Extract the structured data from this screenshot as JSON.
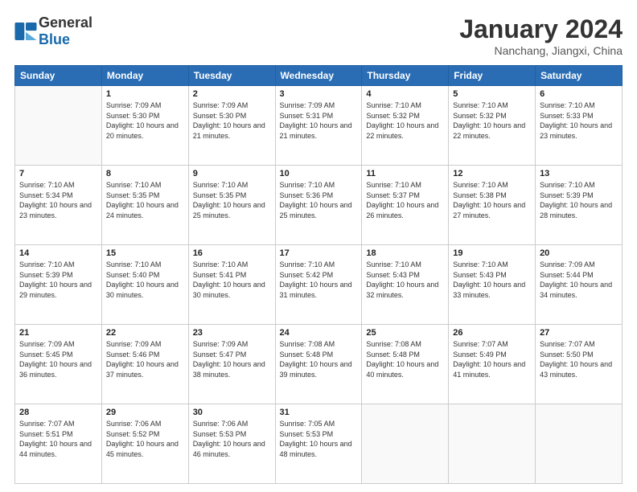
{
  "logo": {
    "text_general": "General",
    "text_blue": "Blue"
  },
  "header": {
    "month": "January 2024",
    "location": "Nanchang, Jiangxi, China"
  },
  "weekdays": [
    "Sunday",
    "Monday",
    "Tuesday",
    "Wednesday",
    "Thursday",
    "Friday",
    "Saturday"
  ],
  "weeks": [
    [
      {
        "day": "",
        "sunrise": "",
        "sunset": "",
        "daylight": ""
      },
      {
        "day": "1",
        "sunrise": "Sunrise: 7:09 AM",
        "sunset": "Sunset: 5:30 PM",
        "daylight": "Daylight: 10 hours and 20 minutes."
      },
      {
        "day": "2",
        "sunrise": "Sunrise: 7:09 AM",
        "sunset": "Sunset: 5:30 PM",
        "daylight": "Daylight: 10 hours and 21 minutes."
      },
      {
        "day": "3",
        "sunrise": "Sunrise: 7:09 AM",
        "sunset": "Sunset: 5:31 PM",
        "daylight": "Daylight: 10 hours and 21 minutes."
      },
      {
        "day": "4",
        "sunrise": "Sunrise: 7:10 AM",
        "sunset": "Sunset: 5:32 PM",
        "daylight": "Daylight: 10 hours and 22 minutes."
      },
      {
        "day": "5",
        "sunrise": "Sunrise: 7:10 AM",
        "sunset": "Sunset: 5:32 PM",
        "daylight": "Daylight: 10 hours and 22 minutes."
      },
      {
        "day": "6",
        "sunrise": "Sunrise: 7:10 AM",
        "sunset": "Sunset: 5:33 PM",
        "daylight": "Daylight: 10 hours and 23 minutes."
      }
    ],
    [
      {
        "day": "7",
        "sunrise": "Sunrise: 7:10 AM",
        "sunset": "Sunset: 5:34 PM",
        "daylight": "Daylight: 10 hours and 23 minutes."
      },
      {
        "day": "8",
        "sunrise": "Sunrise: 7:10 AM",
        "sunset": "Sunset: 5:35 PM",
        "daylight": "Daylight: 10 hours and 24 minutes."
      },
      {
        "day": "9",
        "sunrise": "Sunrise: 7:10 AM",
        "sunset": "Sunset: 5:35 PM",
        "daylight": "Daylight: 10 hours and 25 minutes."
      },
      {
        "day": "10",
        "sunrise": "Sunrise: 7:10 AM",
        "sunset": "Sunset: 5:36 PM",
        "daylight": "Daylight: 10 hours and 25 minutes."
      },
      {
        "day": "11",
        "sunrise": "Sunrise: 7:10 AM",
        "sunset": "Sunset: 5:37 PM",
        "daylight": "Daylight: 10 hours and 26 minutes."
      },
      {
        "day": "12",
        "sunrise": "Sunrise: 7:10 AM",
        "sunset": "Sunset: 5:38 PM",
        "daylight": "Daylight: 10 hours and 27 minutes."
      },
      {
        "day": "13",
        "sunrise": "Sunrise: 7:10 AM",
        "sunset": "Sunset: 5:39 PM",
        "daylight": "Daylight: 10 hours and 28 minutes."
      }
    ],
    [
      {
        "day": "14",
        "sunrise": "Sunrise: 7:10 AM",
        "sunset": "Sunset: 5:39 PM",
        "daylight": "Daylight: 10 hours and 29 minutes."
      },
      {
        "day": "15",
        "sunrise": "Sunrise: 7:10 AM",
        "sunset": "Sunset: 5:40 PM",
        "daylight": "Daylight: 10 hours and 30 minutes."
      },
      {
        "day": "16",
        "sunrise": "Sunrise: 7:10 AM",
        "sunset": "Sunset: 5:41 PM",
        "daylight": "Daylight: 10 hours and 30 minutes."
      },
      {
        "day": "17",
        "sunrise": "Sunrise: 7:10 AM",
        "sunset": "Sunset: 5:42 PM",
        "daylight": "Daylight: 10 hours and 31 minutes."
      },
      {
        "day": "18",
        "sunrise": "Sunrise: 7:10 AM",
        "sunset": "Sunset: 5:43 PM",
        "daylight": "Daylight: 10 hours and 32 minutes."
      },
      {
        "day": "19",
        "sunrise": "Sunrise: 7:10 AM",
        "sunset": "Sunset: 5:43 PM",
        "daylight": "Daylight: 10 hours and 33 minutes."
      },
      {
        "day": "20",
        "sunrise": "Sunrise: 7:09 AM",
        "sunset": "Sunset: 5:44 PM",
        "daylight": "Daylight: 10 hours and 34 minutes."
      }
    ],
    [
      {
        "day": "21",
        "sunrise": "Sunrise: 7:09 AM",
        "sunset": "Sunset: 5:45 PM",
        "daylight": "Daylight: 10 hours and 36 minutes."
      },
      {
        "day": "22",
        "sunrise": "Sunrise: 7:09 AM",
        "sunset": "Sunset: 5:46 PM",
        "daylight": "Daylight: 10 hours and 37 minutes."
      },
      {
        "day": "23",
        "sunrise": "Sunrise: 7:09 AM",
        "sunset": "Sunset: 5:47 PM",
        "daylight": "Daylight: 10 hours and 38 minutes."
      },
      {
        "day": "24",
        "sunrise": "Sunrise: 7:08 AM",
        "sunset": "Sunset: 5:48 PM",
        "daylight": "Daylight: 10 hours and 39 minutes."
      },
      {
        "day": "25",
        "sunrise": "Sunrise: 7:08 AM",
        "sunset": "Sunset: 5:48 PM",
        "daylight": "Daylight: 10 hours and 40 minutes."
      },
      {
        "day": "26",
        "sunrise": "Sunrise: 7:07 AM",
        "sunset": "Sunset: 5:49 PM",
        "daylight": "Daylight: 10 hours and 41 minutes."
      },
      {
        "day": "27",
        "sunrise": "Sunrise: 7:07 AM",
        "sunset": "Sunset: 5:50 PM",
        "daylight": "Daylight: 10 hours and 43 minutes."
      }
    ],
    [
      {
        "day": "28",
        "sunrise": "Sunrise: 7:07 AM",
        "sunset": "Sunset: 5:51 PM",
        "daylight": "Daylight: 10 hours and 44 minutes."
      },
      {
        "day": "29",
        "sunrise": "Sunrise: 7:06 AM",
        "sunset": "Sunset: 5:52 PM",
        "daylight": "Daylight: 10 hours and 45 minutes."
      },
      {
        "day": "30",
        "sunrise": "Sunrise: 7:06 AM",
        "sunset": "Sunset: 5:53 PM",
        "daylight": "Daylight: 10 hours and 46 minutes."
      },
      {
        "day": "31",
        "sunrise": "Sunrise: 7:05 AM",
        "sunset": "Sunset: 5:53 PM",
        "daylight": "Daylight: 10 hours and 48 minutes."
      },
      {
        "day": "",
        "sunrise": "",
        "sunset": "",
        "daylight": ""
      },
      {
        "day": "",
        "sunrise": "",
        "sunset": "",
        "daylight": ""
      },
      {
        "day": "",
        "sunrise": "",
        "sunset": "",
        "daylight": ""
      }
    ]
  ]
}
